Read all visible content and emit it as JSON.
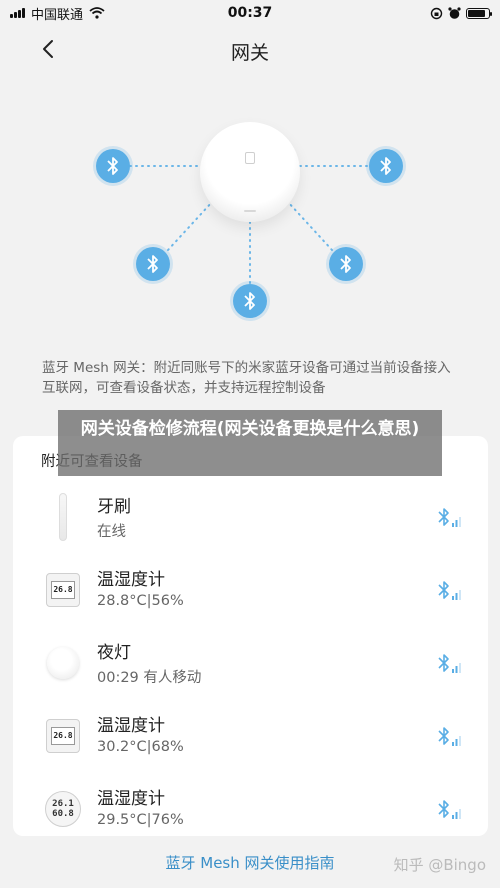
{
  "status_bar": {
    "carrier": "中国联通",
    "time": "00:37",
    "battery_level": 0.85
  },
  "nav": {
    "title": "网关",
    "back_icon": "chevron-left-icon"
  },
  "intro": "蓝牙 Mesh 网关：附近同账号下的米家蓝牙设备可通过当前设备接入互联网，可查看设备状态，并支持远程控制设备",
  "overlay_title": "网关设备检修流程(网关设备更换是什么意思)",
  "device_card": {
    "title": "附近可查看设备",
    "devices": [
      {
        "name": "牙刷",
        "status": "在线",
        "icon": "toothbrush-icon"
      },
      {
        "name": "温湿度计",
        "status": "28.8°C|56%",
        "icon": "hygrometer-square-icon",
        "screen": "26.8"
      },
      {
        "name": "夜灯",
        "status": "00:29 有人移动",
        "icon": "night-light-icon"
      },
      {
        "name": "温湿度计",
        "status": "30.2°C|68%",
        "icon": "hygrometer-square-icon",
        "screen": "26.8"
      },
      {
        "name": "温湿度计",
        "status": "29.5°C|76%",
        "icon": "hygrometer-round-icon",
        "screen_top": "26.1",
        "screen_bottom": "60.8"
      }
    ]
  },
  "bottom_link": "蓝牙 Mesh 网关使用指南",
  "watermark": "知乎 @Bingo",
  "colors": {
    "accent": "#5aaee5",
    "link": "#3a8fc8"
  }
}
